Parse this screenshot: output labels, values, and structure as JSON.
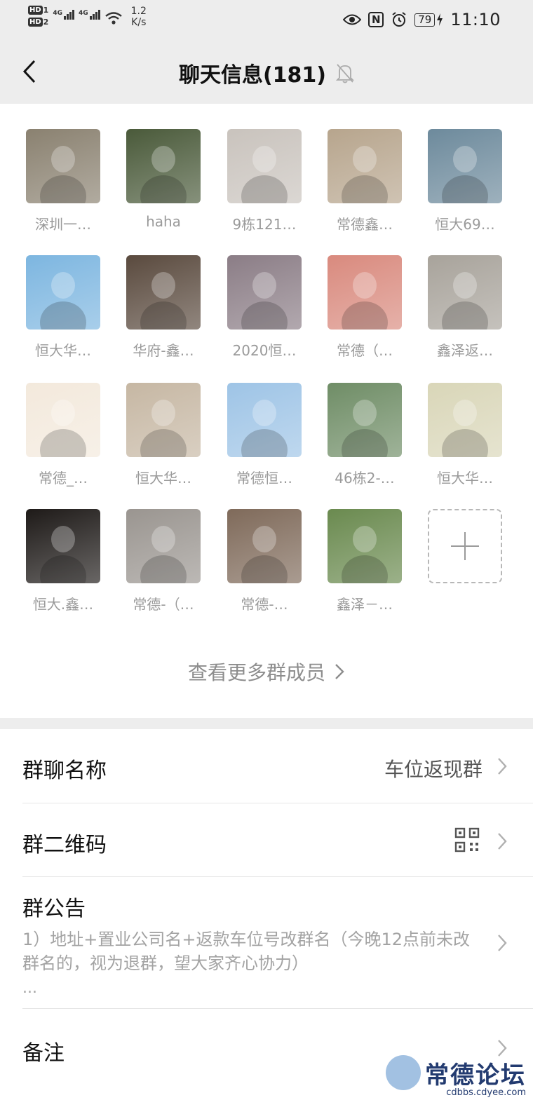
{
  "status_bar": {
    "hd1": "HD",
    "hd1_sub": "1",
    "hd2": "HD",
    "hd2_sub": "2",
    "net1": "4G",
    "net2": "4G",
    "speed_value": "1.2",
    "speed_unit": "K/s",
    "nfc": "N",
    "battery": "79",
    "time": "11:10"
  },
  "header": {
    "title": "聊天信息(181)",
    "icons": [
      "back-arrow-icon",
      "bell-muted-icon"
    ]
  },
  "members": [
    {
      "name": "深圳一…",
      "color": "#8a8170"
    },
    {
      "name": "haha",
      "color": "#4a5a3a"
    },
    {
      "name": "9栋121…",
      "color": "#c9c3bd"
    },
    {
      "name": "常德鑫…",
      "color": "#b7a58d"
    },
    {
      "name": "恒大69…",
      "color": "#6d8a9c"
    },
    {
      "name": "恒大华…",
      "color": "#7db6e0"
    },
    {
      "name": "华府-鑫…",
      "color": "#5a4a3e"
    },
    {
      "name": "2020恒…",
      "color": "#8b7d86"
    },
    {
      "name": "常德（…",
      "color": "#d98a7e"
    },
    {
      "name": "鑫泽返…",
      "color": "#a8a39b"
    },
    {
      "name": "常德_…",
      "color": "#f3e9dc"
    },
    {
      "name": "恒大华…",
      "color": "#c6b7a3"
    },
    {
      "name": "常德恒…",
      "color": "#9ec4e6"
    },
    {
      "name": "46栋2-…",
      "color": "#6f8d66"
    },
    {
      "name": "恒大华…",
      "color": "#d9d6b8"
    },
    {
      "name": "恒大.鑫…",
      "color": "#1e1a18"
    },
    {
      "name": "常德-（…",
      "color": "#9a9590"
    },
    {
      "name": "常德-…",
      "color": "#7f6a5a"
    },
    {
      "name": "鑫泽－…",
      "color": "#6a8a4f"
    }
  ],
  "add_member_icon": "plus-icon",
  "more_members": "查看更多群成员",
  "settings": {
    "group_name_label": "群聊名称",
    "group_name_value": "车位返现群",
    "qr_label": "群二维码",
    "qr_icon": "qr-code-icon",
    "notice_label": "群公告",
    "notice_text": "1）地址+置业公司名+返款车位号改群名（今晚12点前未改群名的，视为退群，望大家齐心协力）",
    "notice_more": "...",
    "remark_label": "备注"
  },
  "watermark": {
    "text": "常德论坛",
    "url": "cdbbs.cdyee.com"
  }
}
